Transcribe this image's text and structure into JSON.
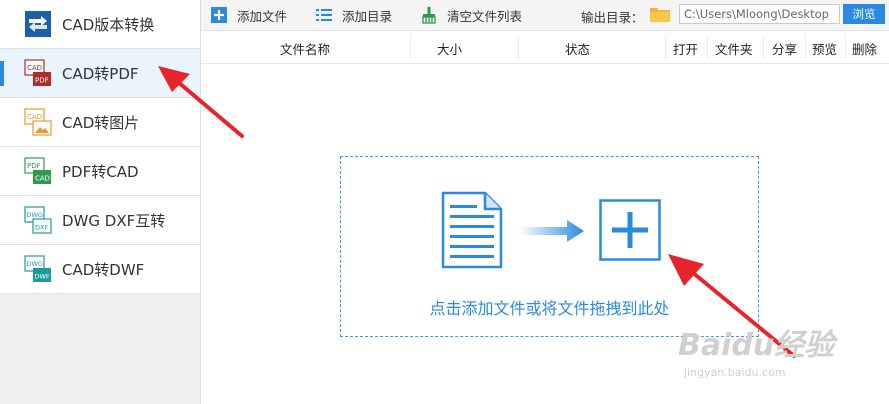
{
  "sidebar": {
    "items": [
      {
        "label": "CAD版本转换",
        "icon": "cad-version-convert-icon"
      },
      {
        "label": "CAD转PDF",
        "icon": "cad-to-pdf-icon",
        "active": true
      },
      {
        "label": "CAD转图片",
        "icon": "cad-to-image-icon"
      },
      {
        "label": "PDF转CAD",
        "icon": "pdf-to-cad-icon"
      },
      {
        "label": "DWG DXF互转",
        "icon": "dwg-dxf-convert-icon"
      },
      {
        "label": "CAD转DWF",
        "icon": "cad-to-dwf-icon"
      }
    ]
  },
  "toolbar": {
    "add_file": "添加文件",
    "add_folder": "添加目录",
    "clear_list": "清空文件列表",
    "output_label": "输出目录：",
    "output_path": "C:\\Users\\Mloong\\Desktop",
    "browse": "浏览"
  },
  "table": {
    "columns": [
      "文件名称",
      "大小",
      "状态",
      "打开",
      "文件夹",
      "分享",
      "预览",
      "删除"
    ]
  },
  "drop_area": {
    "hint": "点击添加文件或将文件拖拽到此处"
  },
  "watermark": {
    "main": "Baidu经验",
    "sub": "jingyan.baidu.com"
  },
  "colors": {
    "accent": "#2b8ae0",
    "annotation": "#e8242b",
    "pdf_red": "#b22a2a",
    "image_orange": "#e89a2a",
    "pdf_green": "#2e9a4e",
    "dwg_teal": "#1f9a9a"
  }
}
